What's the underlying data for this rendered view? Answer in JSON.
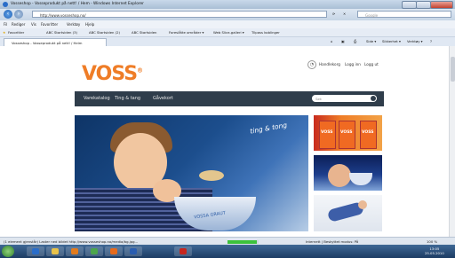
{
  "window": {
    "title": "Vosseshop - Vosseprodukt på nett! / Hem - Windows Internet Explorer",
    "url": "http://www.vosseshop.no/",
    "search_placeholder": "Google",
    "controls": [
      "—",
      "▢",
      "✕"
    ]
  },
  "menubar": {
    "items": [
      "Fil",
      "Rediger",
      "Vis",
      "Favoritter",
      "Verktøy",
      "Hjelp"
    ]
  },
  "favorites": {
    "label": "Favoritter",
    "items": [
      "ABC Startsiden (3)",
      "ABC Startsiden (2)",
      "ABC Startsiden",
      "Foreslåtte områder ▾",
      "Web Slice-galleri ▾",
      "Tilpass koblinger"
    ]
  },
  "tab": {
    "label": "Vosseshop - Vosseprodukt på nett! / Heim"
  },
  "toolbar": {
    "items": [
      "Side ▾",
      "Sikkerhet ▾",
      "Verktøy ▾"
    ]
  },
  "site": {
    "logo": "VOSS",
    "account_links": [
      "Handlekorg",
      "Logg inn",
      "Logg ut"
    ],
    "nav": [
      "Varekatalog",
      "Ting & tang",
      "Gåvekort"
    ],
    "search_placeholder": "Søk",
    "hero_tagline": "ting & tong",
    "bowl_text": "VOSSA GRAUT",
    "bag_text": "VOSS"
  },
  "status": {
    "text": "(1 element gjenstår) Laster ned bildet http://www.vosseshop.no/media/bg.jpg...",
    "zone": "Internett | Beskyttet modus: På",
    "zoom": "100 %",
    "progress": 0.95
  },
  "taskbar": {
    "time": "13:05",
    "date": "25.05.2010"
  },
  "colors": {
    "brand_orange": "#ef7d27",
    "nav_bg": "#2f3d4b",
    "progress_green": "#3cc23c"
  }
}
